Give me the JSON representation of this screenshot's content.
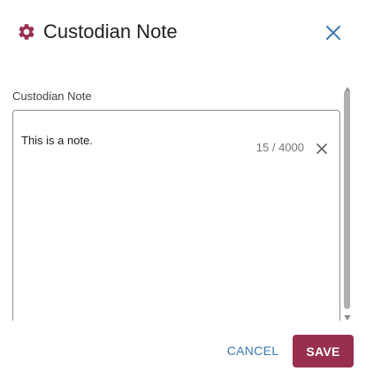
{
  "dialog": {
    "title": "Custodian Note",
    "title_icon": "gear-icon",
    "close_icon": "close-icon"
  },
  "field": {
    "label": "Custodian Note",
    "value": "This is a note.",
    "counter": "15 / 4000",
    "clear_icon": "close-icon"
  },
  "footer": {
    "cancel_label": "CANCEL",
    "save_label": "SAVE"
  },
  "colors": {
    "accent": "#98304d",
    "link": "#3a78b5",
    "border": "#8e8e8e"
  }
}
